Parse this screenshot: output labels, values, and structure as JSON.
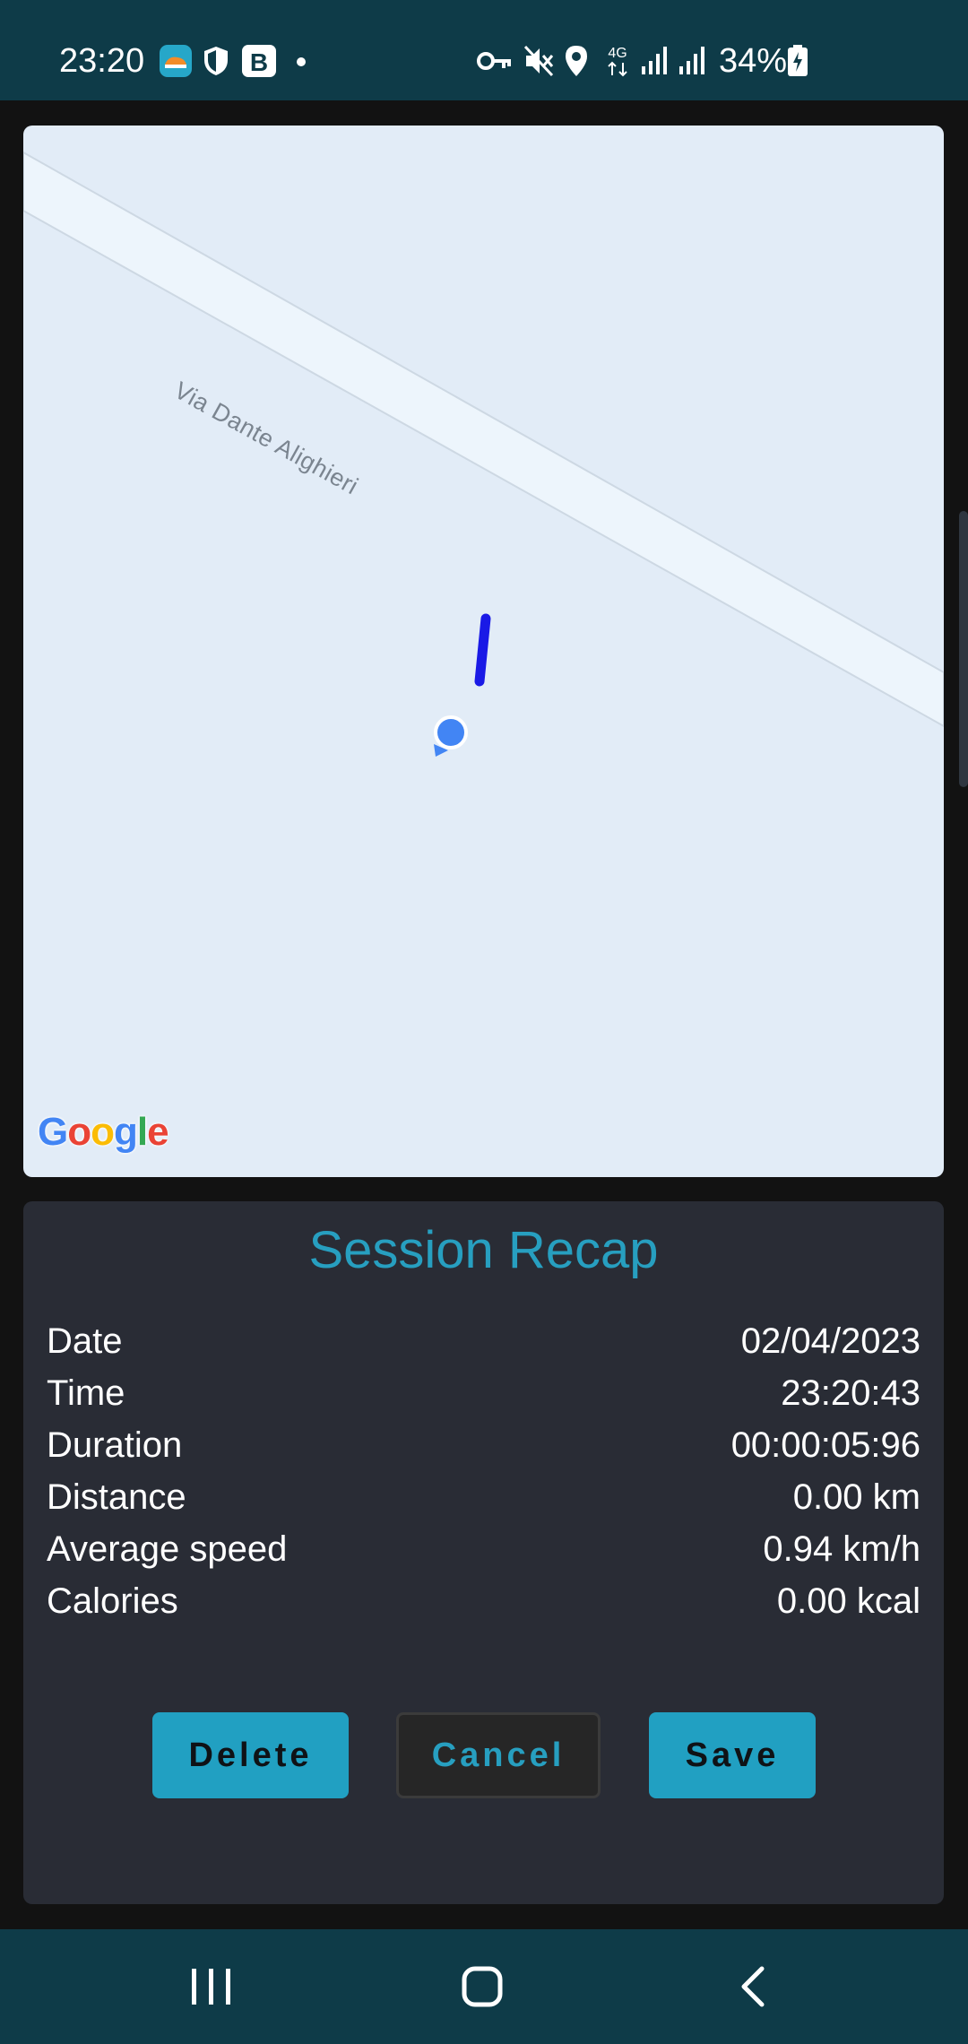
{
  "status_bar": {
    "time": "23:20",
    "battery": "34%",
    "icons": [
      "app-notification-icon",
      "shield-icon",
      "b-app-icon",
      "dot-icon",
      "vpn-key-icon",
      "mute-icon",
      "location-icon",
      "4g-icon",
      "signal-icon",
      "signal-icon",
      "battery-charging-icon"
    ]
  },
  "map": {
    "street_name": "Via Dante Alighieri",
    "provider": "Google",
    "route_color": "#1a1ae6",
    "location_color": "#4285f4"
  },
  "recap": {
    "title": "Session Recap",
    "rows": [
      {
        "label": "Date",
        "value": "02/04/2023"
      },
      {
        "label": "Time",
        "value": "23:20:43"
      },
      {
        "label": "Duration",
        "value": "00:00:05:96"
      },
      {
        "label": "Distance",
        "value": "0.00 km"
      },
      {
        "label": "Average speed",
        "value": "0.94 km/h"
      },
      {
        "label": "Calories",
        "value": "0.00 kcal"
      }
    ],
    "buttons": {
      "delete": "Delete",
      "cancel": "Cancel",
      "save": "Save"
    }
  },
  "nav": {
    "icons": [
      "recent-apps-icon",
      "home-icon",
      "back-icon"
    ]
  },
  "colors": {
    "accent": "#279fc0",
    "button": "#21a0c2",
    "card": "#292c35",
    "bars": "#0e3b48"
  }
}
